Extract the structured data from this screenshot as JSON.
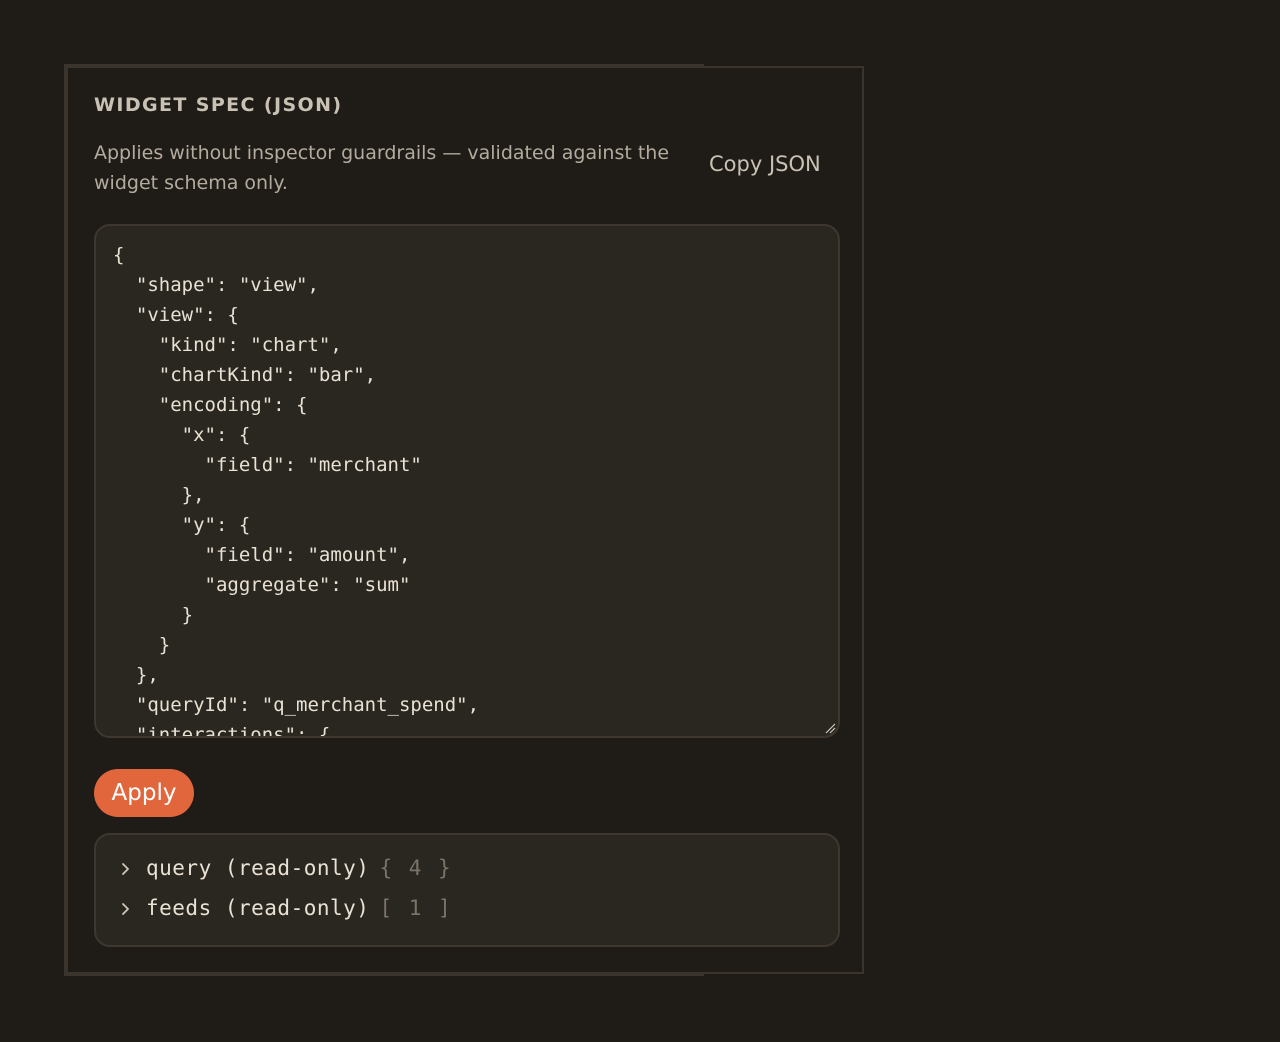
{
  "panel": {
    "title": "WIDGET SPEC (JSON)",
    "description": "Applies without inspector guardrails — validated against the widget schema only.",
    "copy_label": "Copy JSON",
    "apply_label": "Apply",
    "accent_color": "#e2663c"
  },
  "editor": {
    "content": "{\n  \"shape\": \"view\",\n  \"view\": {\n    \"kind\": \"chart\",\n    \"chartKind\": \"bar\",\n    \"encoding\": {\n      \"x\": {\n        \"field\": \"merchant\"\n      },\n      \"y\": {\n        \"field\": \"amount\",\n        \"aggregate\": \"sum\"\n      }\n    }\n  },\n  \"queryId\": \"q_merchant_spend\",\n  \"interactions\": {"
  },
  "readonly": {
    "items": [
      {
        "key": "query (read-only)",
        "meta": "{ 4 }",
        "icon": "chevron-right-icon"
      },
      {
        "key": "feeds (read-only)",
        "meta": "[ 1 ]",
        "icon": "chevron-right-icon"
      }
    ]
  }
}
